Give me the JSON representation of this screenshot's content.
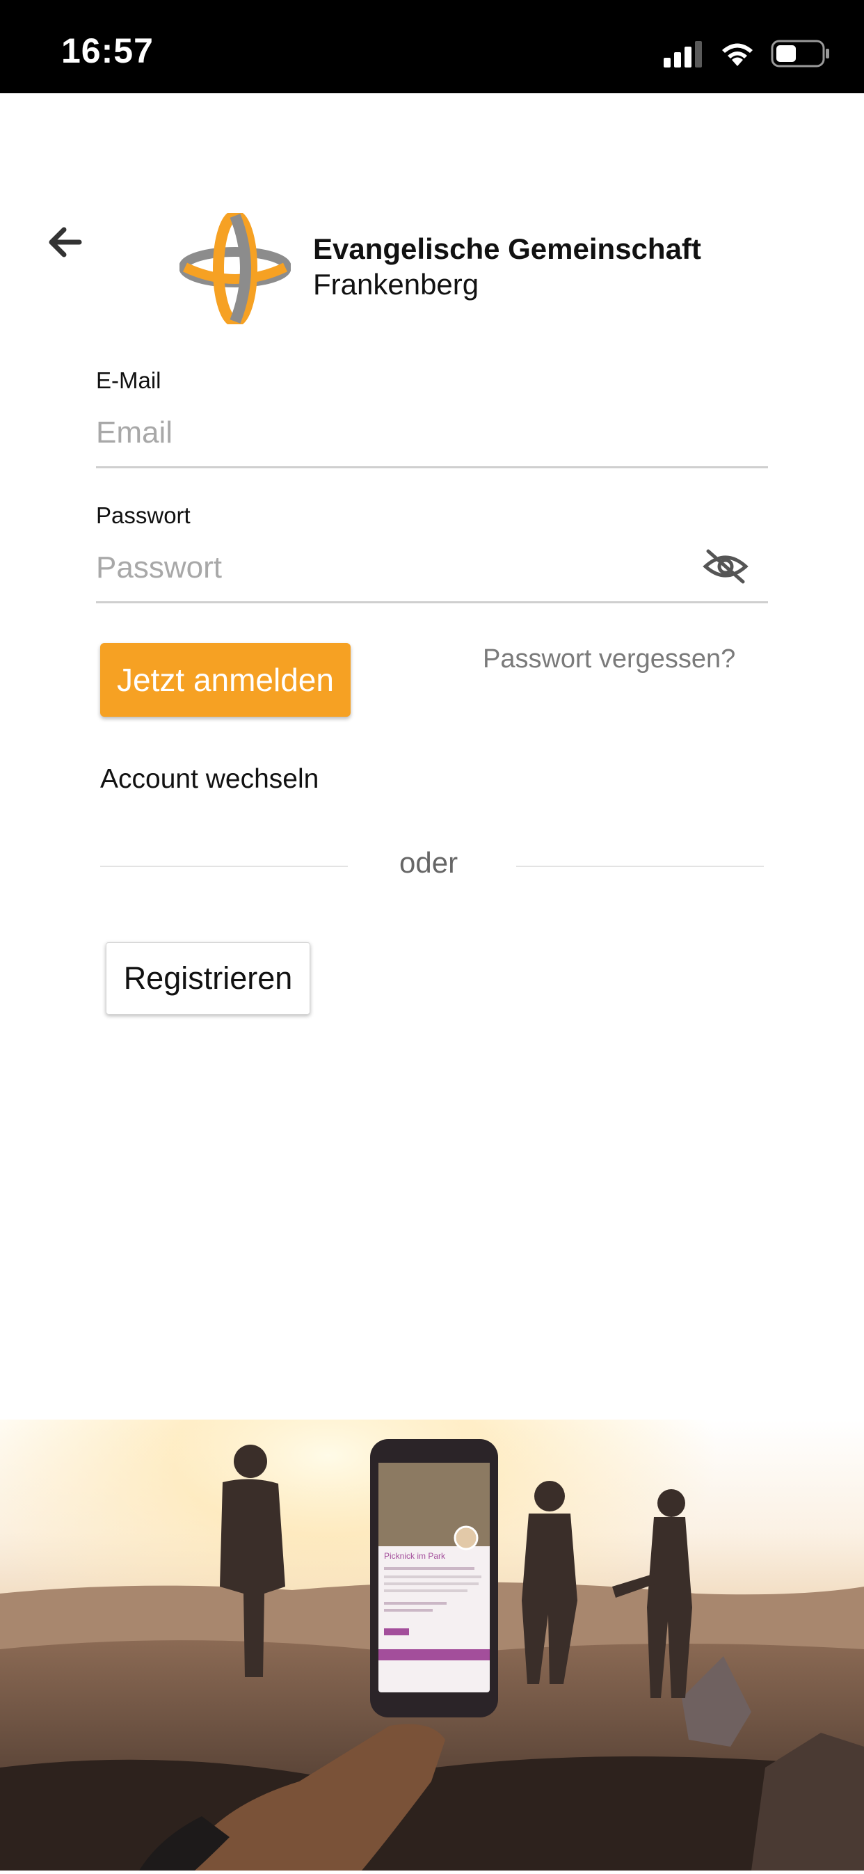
{
  "status_bar": {
    "time": "16:57",
    "icons": [
      "cellular-signal-icon",
      "wifi-icon",
      "battery-icon"
    ]
  },
  "header": {
    "back_icon": "arrow-left-icon",
    "logo_icon": "cross-logo-icon",
    "org_name_line1": "Evangelische Gemeinschaft",
    "org_name_line2": "Frankenberg"
  },
  "login_form": {
    "email": {
      "label": "E-Mail",
      "placeholder": "Email",
      "value": ""
    },
    "password": {
      "label": "Passwort",
      "placeholder": "Passwort",
      "value": "",
      "toggle_icon": "eye-off-icon"
    },
    "submit_label": "Jetzt anmelden",
    "forgot_password_label": "Passwort vergessen?",
    "switch_account_label": "Account wechseln",
    "divider_label": "oder",
    "register_label": "Registrieren"
  },
  "hero_screen": {
    "title": "Picknick im Park"
  },
  "colors": {
    "accent": "#f6a123",
    "logo_grey": "#8c8c8c",
    "status_bar_bg": "#000000",
    "placeholder": "#a8a8a8"
  }
}
